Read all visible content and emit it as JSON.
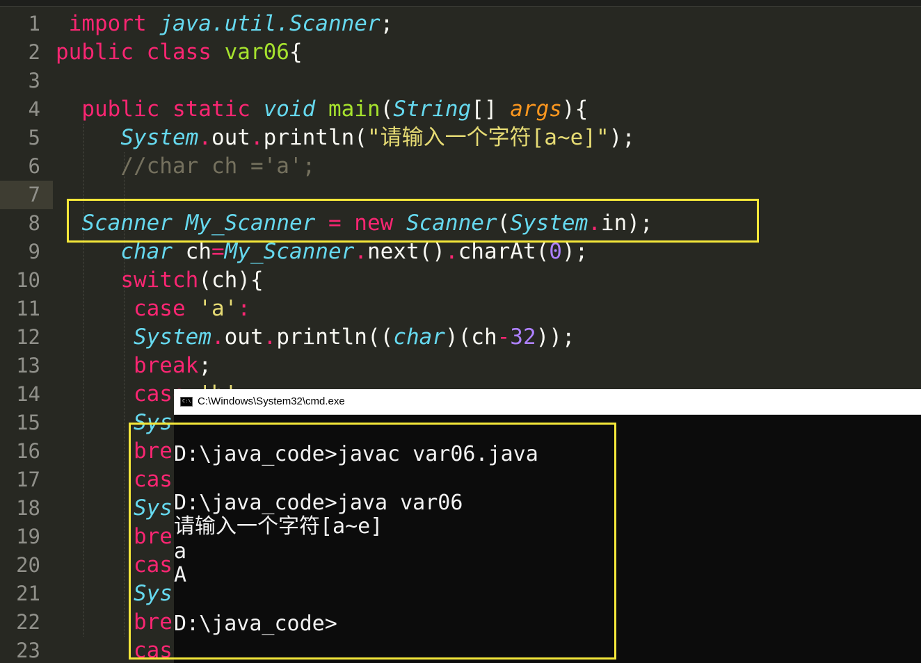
{
  "editor": {
    "line_numbers": [
      "1",
      "2",
      "3",
      "4",
      "5",
      "6",
      "7",
      "8",
      "9",
      "10",
      "11",
      "12",
      "13",
      "14",
      "15",
      "16",
      "17",
      "18",
      "19",
      "20",
      "21",
      "22",
      "23"
    ],
    "active_line": "7",
    "lines": [
      [
        {
          "t": " import ",
          "c": "k"
        },
        {
          "t": "java.util.Scanner",
          "c": "t"
        },
        {
          "t": ";",
          "c": "w"
        }
      ],
      [
        {
          "t": "public class ",
          "c": "k"
        },
        {
          "t": "var06",
          "c": "f"
        },
        {
          "t": "{",
          "c": "w"
        }
      ],
      [],
      [
        {
          "t": "  public static ",
          "c": "k"
        },
        {
          "t": "void ",
          "c": "t"
        },
        {
          "t": "main",
          "c": "f"
        },
        {
          "t": "(",
          "c": "w"
        },
        {
          "t": "String",
          "c": "t"
        },
        {
          "t": "[] ",
          "c": "w"
        },
        {
          "t": "args",
          "c": "a"
        },
        {
          "t": "){",
          "c": "w"
        }
      ],
      [
        {
          "t": "     ",
          "c": "w"
        },
        {
          "t": "System",
          "c": "t"
        },
        {
          "t": ".",
          "c": "k"
        },
        {
          "t": "out",
          "c": "w"
        },
        {
          "t": ".",
          "c": "k"
        },
        {
          "t": "println(",
          "c": "w"
        },
        {
          "t": "\"请输入一个字符[a~e]\"",
          "c": "s"
        },
        {
          "t": ");",
          "c": "w"
        }
      ],
      [
        {
          "t": "     //char ch ='a';",
          "c": "c"
        }
      ],
      [],
      [
        {
          "t": "  ",
          "c": "w"
        },
        {
          "t": "Scanner My_Scanner",
          "c": "t"
        },
        {
          "t": " = ",
          "c": "k"
        },
        {
          "t": "new ",
          "c": "k"
        },
        {
          "t": "Scanner",
          "c": "t"
        },
        {
          "t": "(",
          "c": "w"
        },
        {
          "t": "System",
          "c": "t"
        },
        {
          "t": ".",
          "c": "k"
        },
        {
          "t": "in);",
          "c": "w"
        }
      ],
      [
        {
          "t": "     ",
          "c": "w"
        },
        {
          "t": "char ",
          "c": "t"
        },
        {
          "t": "ch",
          "c": "w"
        },
        {
          "t": "=",
          "c": "k"
        },
        {
          "t": "My_Scanner",
          "c": "t"
        },
        {
          "t": ".",
          "c": "k"
        },
        {
          "t": "next()",
          "c": "w"
        },
        {
          "t": ".",
          "c": "k"
        },
        {
          "t": "charAt(",
          "c": "w"
        },
        {
          "t": "0",
          "c": "n"
        },
        {
          "t": ");",
          "c": "w"
        }
      ],
      [
        {
          "t": "     ",
          "c": "w"
        },
        {
          "t": "switch",
          "c": "k"
        },
        {
          "t": "(ch){",
          "c": "w"
        }
      ],
      [
        {
          "t": "      ",
          "c": "w"
        },
        {
          "t": "case ",
          "c": "k"
        },
        {
          "t": "'a'",
          "c": "s"
        },
        {
          "t": ":",
          "c": "k"
        }
      ],
      [
        {
          "t": "      ",
          "c": "w"
        },
        {
          "t": "System",
          "c": "t"
        },
        {
          "t": ".",
          "c": "k"
        },
        {
          "t": "out",
          "c": "w"
        },
        {
          "t": ".",
          "c": "k"
        },
        {
          "t": "println((",
          "c": "w"
        },
        {
          "t": "char",
          "c": "t"
        },
        {
          "t": ")(ch",
          "c": "w"
        },
        {
          "t": "-",
          "c": "k"
        },
        {
          "t": "32",
          "c": "n"
        },
        {
          "t": "));",
          "c": "w"
        }
      ],
      [
        {
          "t": "      ",
          "c": "w"
        },
        {
          "t": "break",
          "c": "k"
        },
        {
          "t": ";",
          "c": "w"
        }
      ],
      [
        {
          "t": "      ",
          "c": "w"
        },
        {
          "t": "case ",
          "c": "k"
        },
        {
          "t": "'b'",
          "c": "s"
        }
      ],
      [
        {
          "t": "      ",
          "c": "w"
        },
        {
          "t": "Sys",
          "c": "t"
        }
      ],
      [
        {
          "t": "      ",
          "c": "w"
        },
        {
          "t": "bre",
          "c": "k"
        }
      ],
      [
        {
          "t": "      ",
          "c": "w"
        },
        {
          "t": "cas",
          "c": "k"
        }
      ],
      [
        {
          "t": "      ",
          "c": "w"
        },
        {
          "t": "Sys",
          "c": "t"
        }
      ],
      [
        {
          "t": "      ",
          "c": "w"
        },
        {
          "t": "bre",
          "c": "k"
        }
      ],
      [
        {
          "t": "      ",
          "c": "w"
        },
        {
          "t": "cas",
          "c": "k"
        }
      ],
      [
        {
          "t": "      ",
          "c": "w"
        },
        {
          "t": "Sys",
          "c": "t"
        }
      ],
      [
        {
          "t": "      ",
          "c": "w"
        },
        {
          "t": "bre",
          "c": "k"
        }
      ],
      [
        {
          "t": "      ",
          "c": "w"
        },
        {
          "t": "cas",
          "c": "k"
        }
      ]
    ]
  },
  "colors": {
    "editor_bg": "#272822",
    "keyword": "#f92672",
    "type": "#66d9ef",
    "function": "#a6e22e",
    "argument": "#fd971f",
    "string": "#e6db74",
    "number": "#ae81ff",
    "comment": "#75715e",
    "highlight_box": "#f5e83a",
    "console_bg": "#0c0c0c"
  },
  "console": {
    "icon": "C:\\",
    "title": "C:\\Windows\\System32\\cmd.exe",
    "lines": [
      "D:\\java_code>javac var06.java",
      "D:\\java_code>java var06",
      "请输入一个字符[a~e]",
      "a",
      "A",
      "D:\\java_code>"
    ]
  }
}
